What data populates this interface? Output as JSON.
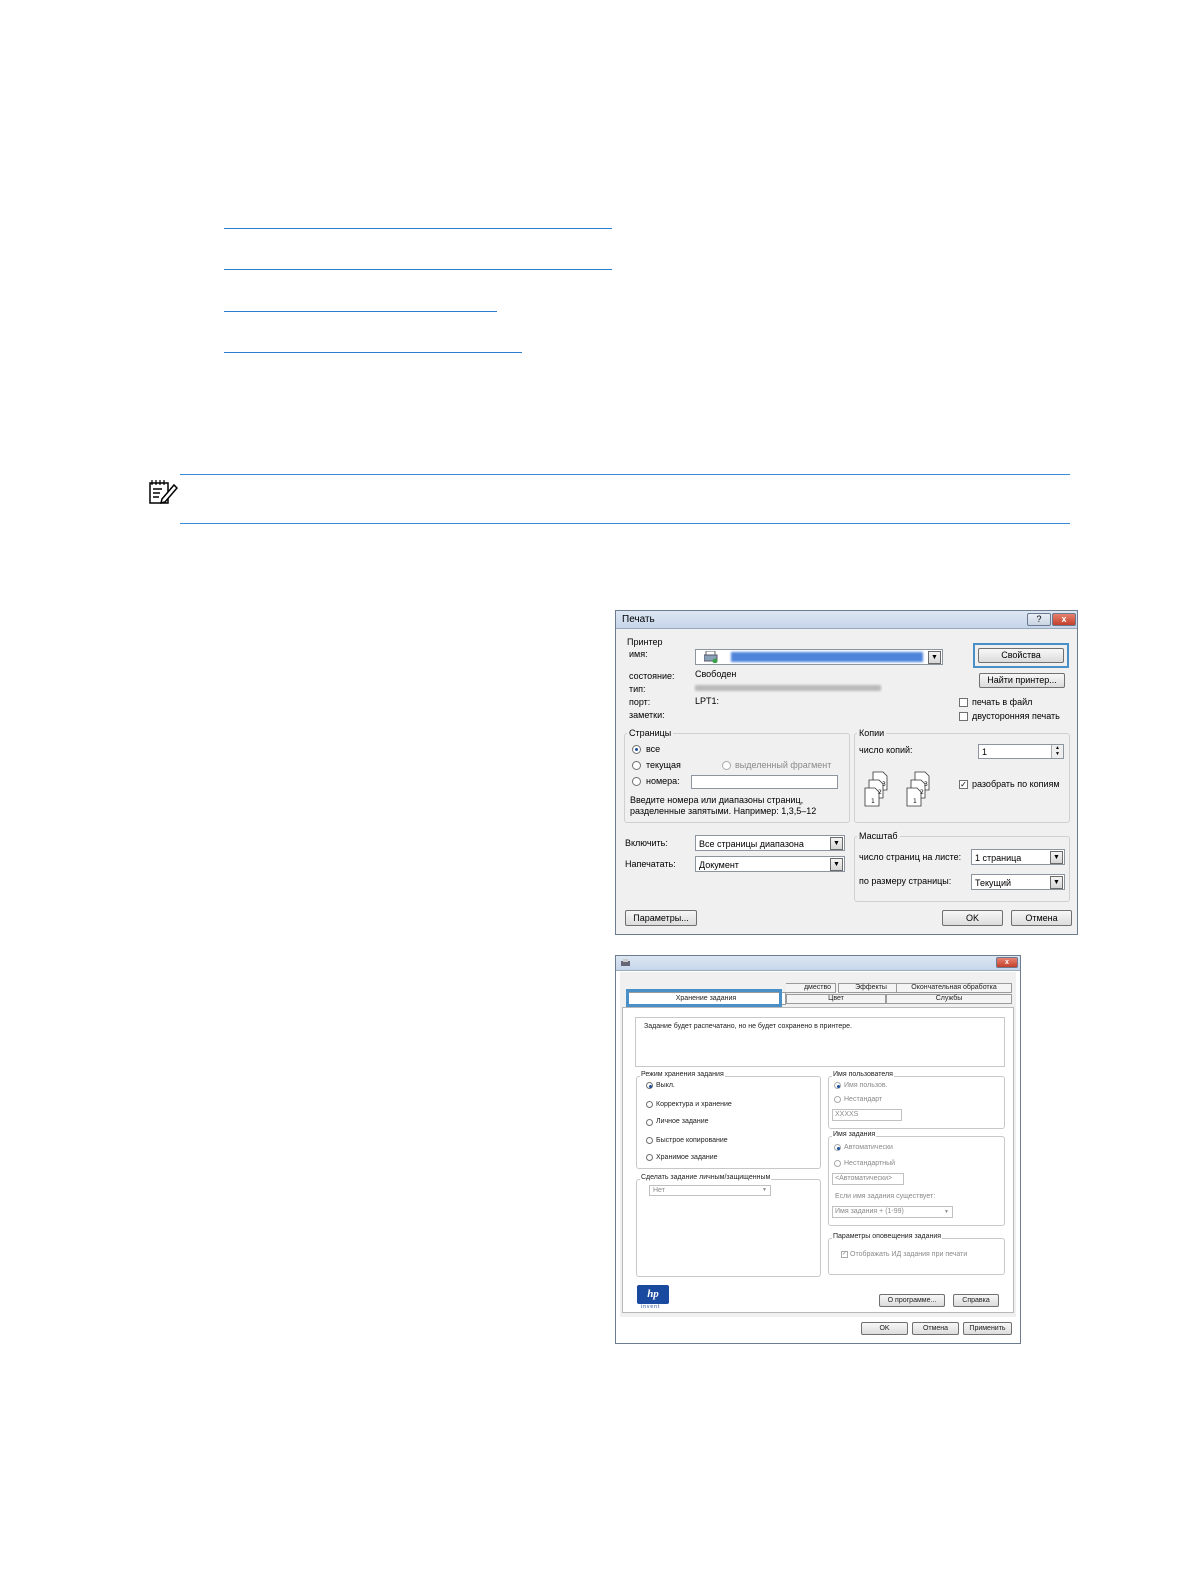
{
  "print_dialog": {
    "title": "Печать",
    "help_btn": "?",
    "close_btn": "x",
    "printer_group": "Принтер",
    "name_label": "имя:",
    "status_label": "состояние:",
    "status_value": "Свободен",
    "type_label": "тип:",
    "port_label": "порт:",
    "port_value": "LPT1:",
    "notes_label": "заметки:",
    "properties_btn": "Свойства",
    "find_printer_btn": "Найти принтер...",
    "print_to_file": "печать в файл",
    "duplex": "двусторонняя печать",
    "pages_group": "Страницы",
    "all": "все",
    "current": "текущая",
    "selection": "выделенный фрагмент",
    "numbers": "номера:",
    "hint_line1": "Введите номера или диапазоны страниц,",
    "hint_line2": "разделенные запятыми. Например: 1,3,5–12",
    "copies_group": "Копии",
    "copies_label": "число копий:",
    "copies_value": "1",
    "collate": "разобрать по копиям",
    "include_label": "Включить:",
    "include_value": "Все страницы диапазона",
    "print_what_label": "Напечатать:",
    "print_what_value": "Документ",
    "scale_group": "Масштаб",
    "pages_per_sheet_label": "число страниц на листе:",
    "pages_per_sheet_value": "1 страница",
    "scale_to_label": "по размеру страницы:",
    "scale_to_value": "Текущий",
    "options_btn": "Параметры...",
    "ok_btn": "OK",
    "cancel_btn": "Отмена"
  },
  "properties_dialog": {
    "close_btn": "x",
    "tabs_top": [
      "дмество",
      "Эффекты",
      "Окончательная обработка"
    ],
    "tabs_bottom": [
      "Хранение задания",
      "Цвет",
      "Службы"
    ],
    "description": "Задание будет распечатано, но не будет сохранено в принтере.",
    "mode_group": "Режим хранения задания",
    "mode_off": "Выкл.",
    "mode_proof": "Корректура и хранение",
    "mode_personal": "Личное задание",
    "mode_quick": "Быстрое копирование",
    "mode_stored": "Хранимое задание",
    "private_group": "Сделать задание личным/защищенным",
    "private_value": "Нет",
    "user_group": "Имя пользователя",
    "user_default": "Имя пользов.",
    "user_custom": "Нестандарт",
    "user_value": "XXXXS",
    "job_group": "Имя задания",
    "job_auto": "Автоматически",
    "job_custom": "Нестандартный",
    "job_value": "<Автоматически>",
    "exists_label": "Если имя задания существует:",
    "exists_value": "Имя задания + (1-99)",
    "notify_group": "Параметры оповещения задания",
    "notify_check": "Отображать ИД задания при печати",
    "hp_logo": "hp",
    "hp_invent": "invent",
    "about_btn": "О программе...",
    "help_btn": "Справка",
    "ok_btn": "OK",
    "cancel_btn": "Отмена",
    "apply_btn": "Применить"
  }
}
